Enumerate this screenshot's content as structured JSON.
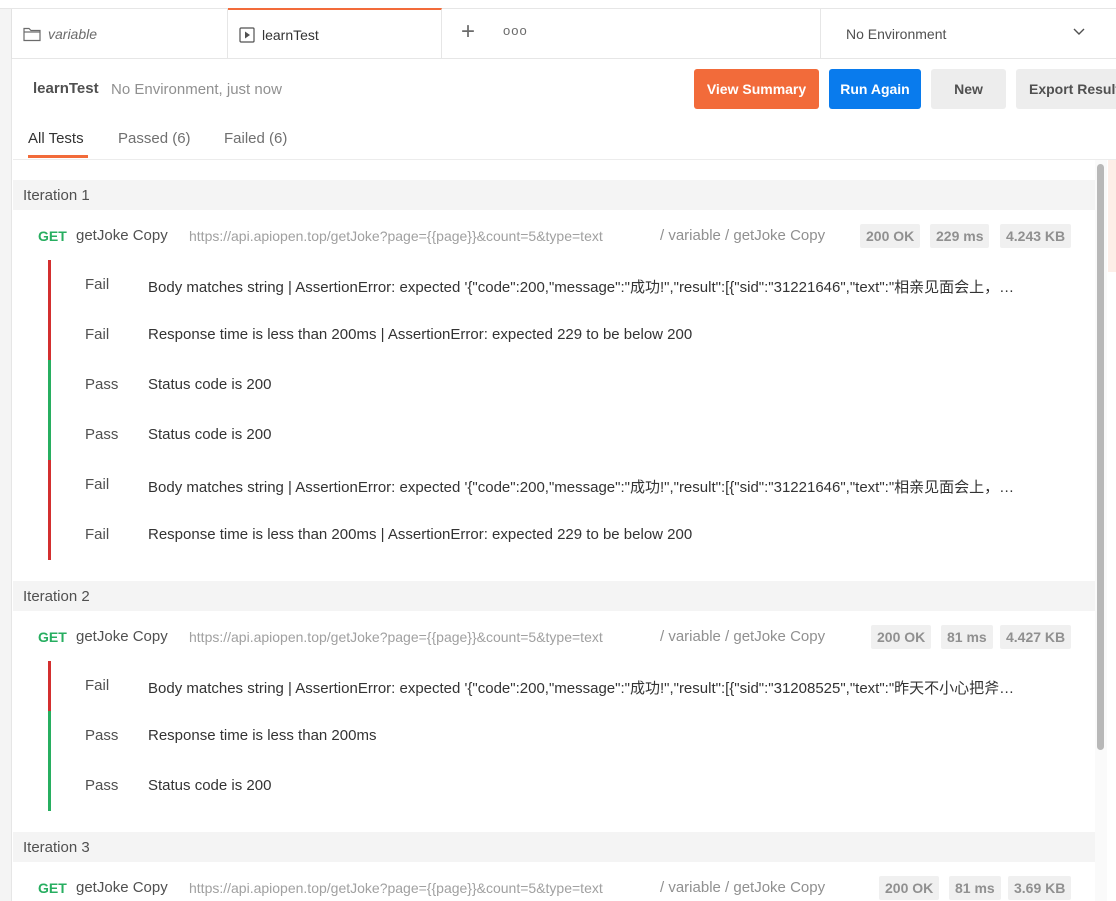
{
  "tabs": {
    "variable_label": "variable",
    "learn_label": "learnTest",
    "add_symbol": "+",
    "more_symbol": "ooo",
    "environment": "No Environment"
  },
  "header": {
    "title": "learnTest",
    "subtitle": "No Environment, just now",
    "view_summary": "View Summary",
    "run_again": "Run Again",
    "new": "New",
    "export": "Export Results"
  },
  "filters": {
    "all": "All Tests",
    "passed": "Passed (6)",
    "failed": "Failed (6)"
  },
  "iterations": [
    {
      "label": "Iteration 1",
      "method": "GET",
      "name": "getJoke Copy",
      "url": "https://api.apiopen.top/getJoke?page={{page}}&count=5&type=text",
      "path": "/ variable / getJoke Copy",
      "status": "200 OK",
      "time": "229 ms",
      "size": "4.243 KB",
      "tests": [
        {
          "result": "Fail",
          "text": "Body matches string | AssertionError: expected '{\"code\":200,\"message\":\"成功!\",\"result\":[{\"sid\":\"31221646\",\"text\":\"相亲见面会上，…"
        },
        {
          "result": "Fail",
          "text": "Response time is less than 200ms | AssertionError: expected 229 to be below 200"
        },
        {
          "result": "Pass",
          "text": "Status code is 200"
        },
        {
          "result": "Pass",
          "text": "Status code is 200"
        },
        {
          "result": "Fail",
          "text": "Body matches string | AssertionError: expected '{\"code\":200,\"message\":\"成功!\",\"result\":[{\"sid\":\"31221646\",\"text\":\"相亲见面会上，…"
        },
        {
          "result": "Fail",
          "text": "Response time is less than 200ms | AssertionError: expected 229 to be below 200"
        }
      ]
    },
    {
      "label": "Iteration 2",
      "method": "GET",
      "name": "getJoke Copy",
      "url": "https://api.apiopen.top/getJoke?page={{page}}&count=5&type=text",
      "path": "/ variable / getJoke Copy",
      "status": "200 OK",
      "time": "81 ms",
      "size": "4.427 KB",
      "tests": [
        {
          "result": "Fail",
          "text": "Body matches string | AssertionError: expected '{\"code\":200,\"message\":\"成功!\",\"result\":[{\"sid\":\"31208525\",\"text\":\"昨天不小心把斧…"
        },
        {
          "result": "Pass",
          "text": "Response time is less than 200ms"
        },
        {
          "result": "Pass",
          "text": "Status code is 200"
        }
      ]
    },
    {
      "label": "Iteration 3",
      "method": "GET",
      "name": "getJoke Copy",
      "url": "https://api.apiopen.top/getJoke?page={{page}}&count=5&type=text",
      "path": "/ variable / getJoke Copy",
      "status": "200 OK",
      "time": "81 ms",
      "size": "3.69 KB",
      "tests": []
    }
  ],
  "colors": {
    "accent": "#f26b3a",
    "primary": "#097bed",
    "fail": "#d32f2f",
    "pass": "#27ae60"
  },
  "icons": [
    "folder-icon",
    "runner-icon",
    "chevron-down-icon"
  ]
}
